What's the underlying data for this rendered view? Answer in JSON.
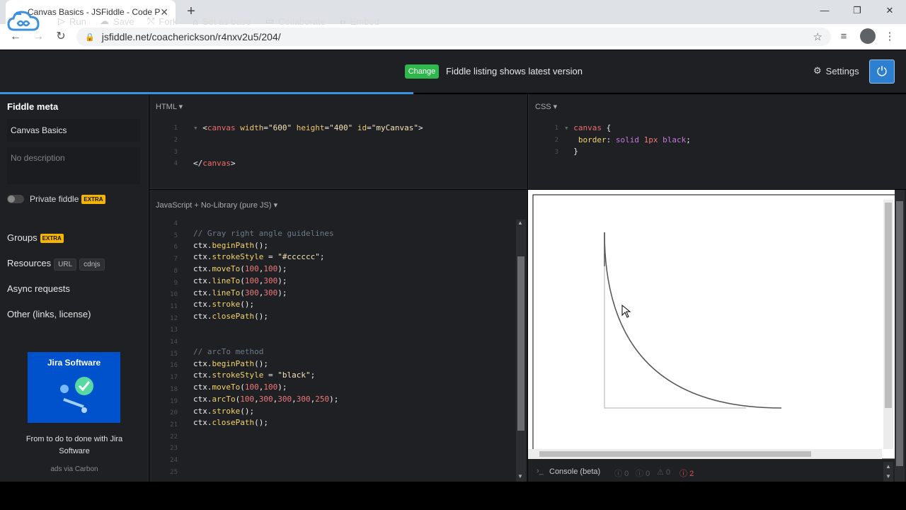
{
  "browser": {
    "tab_title": "Canvas Basics - JSFiddle - Code P",
    "tab_close": "✕",
    "new_tab": "+",
    "url": "jsfiddle.net/coacherickson/r4nxv2u5/204/"
  },
  "toolbar": {
    "run": "Run",
    "save": "Save",
    "fork": "Fork",
    "set_base": "Set as base",
    "collaborate": "Collaborate",
    "embed": "Embed",
    "change": "Change",
    "listing_note": "Fiddle listing shows latest version",
    "settings": "Settings"
  },
  "sidebar": {
    "meta_title": "Fiddle meta",
    "fiddle_name": "Canvas Basics",
    "description_placeholder": "No description",
    "private_label": "Private fiddle",
    "extra_badge": "EXTRA",
    "groups": "Groups",
    "resources": "Resources",
    "url_chip": "URL",
    "cdnjs_chip": "cdnjs",
    "async": "Async requests",
    "other": "Other (links, license)",
    "ad_brand": "Jira Software",
    "ad_text": "From to do to done with Jira Software",
    "ad_via": "ads via Carbon"
  },
  "html_panel": {
    "label": "HTML ▾",
    "line_numbers": [
      "1",
      "2",
      "3",
      "4"
    ]
  },
  "css_panel": {
    "label": "CSS ▾",
    "line_numbers": [
      "1",
      "2",
      "3"
    ]
  },
  "js_panel": {
    "label": "JavaScript + No-Library (pure JS) ▾",
    "line_numbers": [
      "4",
      "5",
      "6",
      "7",
      "8",
      "9",
      "10",
      "11",
      "12",
      "13",
      "14",
      "15",
      "16",
      "17",
      "18",
      "19",
      "20",
      "21",
      "22",
      "23",
      "24",
      "25"
    ]
  },
  "console": {
    "label": "Console (beta)",
    "counts": [
      "0",
      "0",
      "0",
      "2"
    ]
  },
  "colors": {
    "accent": "#3d8fe0",
    "change_green": "#2fb64c",
    "extra_badge": "#f4b400",
    "error_red": "#e05252"
  }
}
